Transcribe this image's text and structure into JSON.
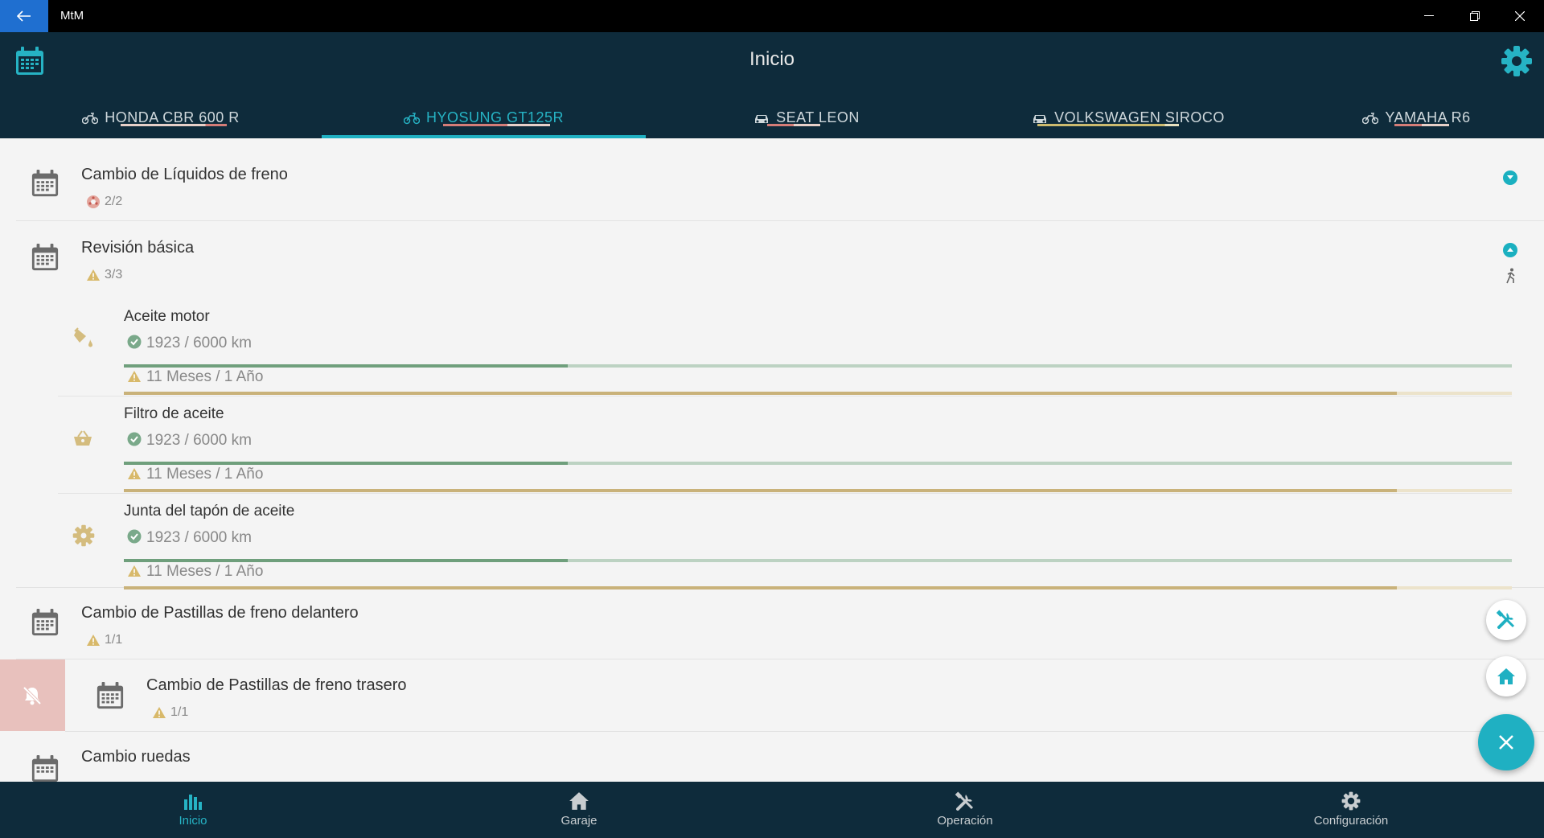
{
  "window": {
    "title": "MtM"
  },
  "header": {
    "title": "Inicio"
  },
  "tabs": [
    {
      "label": "HONDA CBR 600 R",
      "icon": "motorcycle-icon",
      "active": false
    },
    {
      "label": "HYOSUNG GT125R",
      "icon": "motorcycle-icon",
      "active": true
    },
    {
      "label": "SEAT LEON",
      "icon": "car-icon",
      "active": false
    },
    {
      "label": "VOLKSWAGEN SIROCO",
      "icon": "car-icon",
      "active": false
    },
    {
      "label": "YAMAHA R6",
      "icon": "motorcycle-icon",
      "active": false
    }
  ],
  "maintenance": [
    {
      "title": "Cambio de Líquidos de freno",
      "status": "2/2",
      "status_icon": "alert-round-icon"
    },
    {
      "title": "Revisión básica",
      "status": "3/3",
      "status_icon": "warning-icon",
      "items": [
        {
          "title": "Aceite motor",
          "icon": "oil-can-icon",
          "distance": "1923 / 6000 km",
          "distance_progress": 0.32,
          "time": "11 Meses / 1 Año",
          "time_progress": 0.917
        },
        {
          "title": "Filtro de aceite",
          "icon": "basket-icon",
          "distance": "1923 / 6000 km",
          "distance_progress": 0.32,
          "time": "11 Meses / 1 Año",
          "time_progress": 0.917
        },
        {
          "title": "Junta del tapón de aceite",
          "icon": "gear-icon",
          "distance": "1923 / 6000 km",
          "distance_progress": 0.32,
          "time": "11 Meses / 1 Año",
          "time_progress": 0.917
        }
      ]
    },
    {
      "title": "Cambio de Pastillas de freno delantero",
      "status": "1/1",
      "status_icon": "warning-icon"
    },
    {
      "title": "Cambio de Pastillas de freno trasero",
      "status": "1/1",
      "status_icon": "warning-icon",
      "muted": true
    },
    {
      "title": "Cambio ruedas",
      "status": "",
      "status_icon": ""
    }
  ],
  "bottom_nav": [
    {
      "label": "Inicio",
      "icon": "chart-icon",
      "active": true
    },
    {
      "label": "Garaje",
      "icon": "home-icon",
      "active": false
    },
    {
      "label": "Operación",
      "icon": "tools-icon",
      "active": false
    },
    {
      "label": "Configuración",
      "icon": "gear-icon",
      "active": false
    }
  ],
  "colors": {
    "header": "#0e2b3b",
    "accent": "#1fb0c2",
    "km_bar": "#6f9f7c",
    "time_bar": "#c9b27a",
    "warning": "#d8b96a",
    "muted_swipe": "#e8c1bd"
  }
}
